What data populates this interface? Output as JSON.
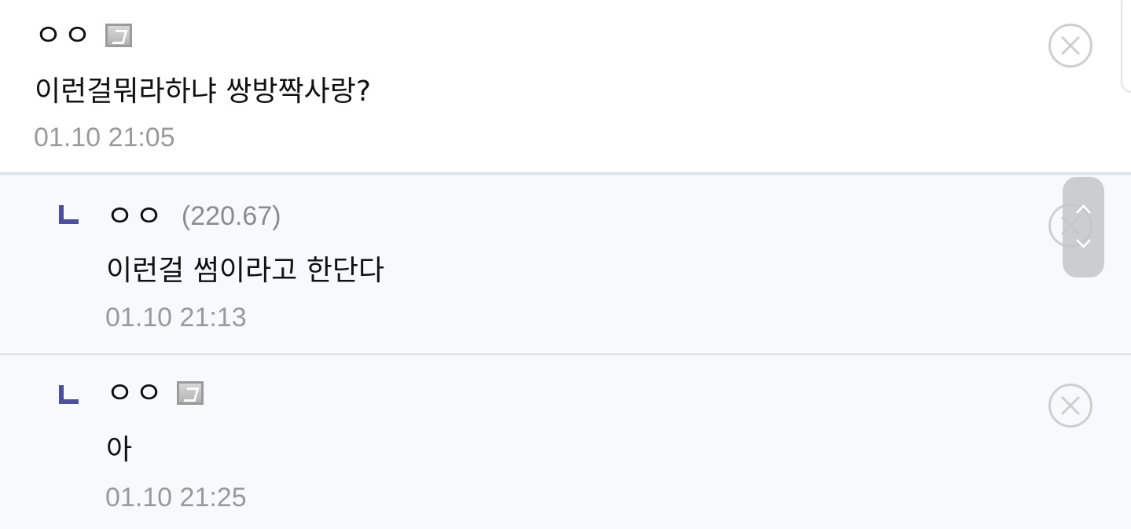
{
  "comments": [
    {
      "author": "ㅇㅇ",
      "badge": "fixed-nick-icon",
      "ip": "",
      "text": "이런걸뭐라하냐 쌍방짝사랑?",
      "time": "01.10 21:05",
      "is_reply": false
    },
    {
      "author": "ㅇㅇ",
      "badge": "",
      "ip": "(220.67)",
      "text": "이런걸 썸이라고 한단다",
      "time": "01.10 21:13",
      "is_reply": true
    },
    {
      "author": "ㅇㅇ",
      "badge": "fixed-nick-icon",
      "ip": "",
      "text": "아",
      "time": "01.10 21:25",
      "is_reply": true
    }
  ],
  "icons": {
    "delete": "close-circle-icon",
    "reply": "reply-arrow-icon",
    "scroll": "scroll-up-down-icon"
  },
  "colors": {
    "reply_mark": "#4b4f9c",
    "reply_background": "#f8f9fc",
    "divider": "#e2e4ee",
    "timestamp": "#9a9a9a",
    "delete_icon": "#cfcfcf"
  }
}
